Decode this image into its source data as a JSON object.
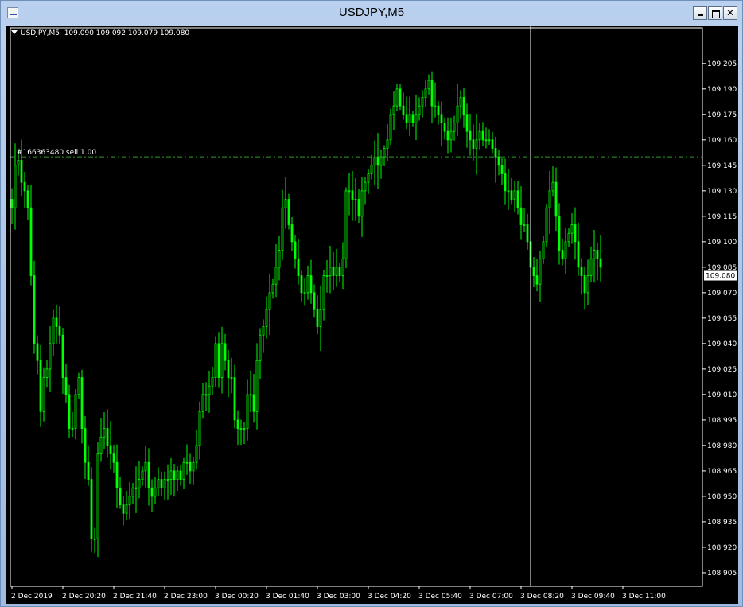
{
  "window": {
    "title": "USDJPY,M5",
    "buttons": {
      "minimize": "minimize",
      "maximize": "maximize",
      "close": "✕"
    }
  },
  "header": {
    "symbol": "USDJPY,M5",
    "ohlc": "109.090 109.092 109.079 109.080"
  },
  "colors": {
    "background": "#000000",
    "bull": "#00ff00",
    "bear": "#00ff00",
    "grid_line": "#ffffff",
    "order_line": "#2e9a2e",
    "price_label_bg": "#ffffff",
    "price_label_text": "#000000"
  },
  "order": {
    "label": "#166363480 sell 1.00",
    "price": 109.15
  },
  "current_price": {
    "value": 109.08,
    "label": "109.080"
  },
  "chart_data": {
    "type": "candlestick",
    "symbol": "USDJPY",
    "timeframe": "M5",
    "ylim": [
      108.897,
      109.226
    ],
    "yticks": [
      "109.205",
      "109.190",
      "109.175",
      "109.160",
      "109.145",
      "109.130",
      "109.115",
      "109.100",
      "109.085",
      "109.070",
      "109.055",
      "109.040",
      "109.025",
      "109.010",
      "108.995",
      "108.980",
      "108.965",
      "108.950",
      "108.935",
      "108.920",
      "108.905"
    ],
    "xticks": [
      "2 Dec 2019",
      "2 Dec 20:20",
      "2 Dec 21:40",
      "2 Dec 23:00",
      "3 Dec 00:20",
      "3 Dec 01:40",
      "3 Dec 03:00",
      "3 Dec 04:20",
      "3 Dec 05:40",
      "3 Dec 07:00",
      "3 Dec 08:20",
      "3 Dec 09:40",
      "3 Dec 11:00"
    ],
    "xtick_bars": [
      0,
      16,
      32,
      48,
      64,
      80,
      96,
      112,
      128,
      144,
      160,
      176,
      192
    ],
    "cursor_bar": 163,
    "series": [
      {
        "close_path": [
          [
            0,
            109.12
          ],
          [
            1,
            109.145
          ],
          [
            2,
            109.148
          ],
          [
            3,
            109.135
          ],
          [
            4,
            109.13
          ],
          [
            5,
            109.12
          ],
          [
            6,
            109.08
          ],
          [
            7,
            109.04
          ],
          [
            8,
            109.03
          ],
          [
            9,
            109.0
          ],
          [
            10,
            109.02
          ],
          [
            11,
            109.025
          ],
          [
            12,
            109.04
          ],
          [
            13,
            109.055
          ],
          [
            14,
            109.05
          ],
          [
            15,
            109.045
          ],
          [
            16,
            109.02
          ],
          [
            17,
            109.01
          ],
          [
            18,
            108.99
          ],
          [
            19,
            108.99
          ],
          [
            20,
            109.01
          ],
          [
            21,
            109.02
          ],
          [
            22,
            108.99
          ],
          [
            23,
            108.97
          ],
          [
            24,
            108.96
          ],
          [
            25,
            108.925
          ],
          [
            26,
            108.925
          ],
          [
            27,
            108.975
          ],
          [
            28,
            108.985
          ],
          [
            29,
            108.99
          ],
          [
            30,
            108.98
          ],
          [
            31,
            108.975
          ],
          [
            32,
            108.97
          ],
          [
            33,
            108.955
          ],
          [
            34,
            108.945
          ],
          [
            35,
            108.94
          ],
          [
            36,
            108.945
          ],
          [
            37,
            108.95
          ],
          [
            38,
            108.955
          ],
          [
            39,
            108.955
          ],
          [
            40,
            108.96
          ],
          [
            41,
            108.965
          ],
          [
            42,
            108.97
          ],
          [
            43,
            108.955
          ],
          [
            44,
            108.95
          ],
          [
            45,
            108.955
          ],
          [
            46,
            108.96
          ],
          [
            47,
            108.955
          ],
          [
            48,
            108.96
          ],
          [
            49,
            108.96
          ],
          [
            50,
            108.965
          ],
          [
            51,
            108.96
          ],
          [
            52,
            108.965
          ],
          [
            53,
            108.96
          ],
          [
            54,
            108.97
          ],
          [
            55,
            108.97
          ],
          [
            56,
            108.965
          ],
          [
            57,
            108.97
          ],
          [
            58,
            108.98
          ],
          [
            59,
            109.0
          ],
          [
            60,
            109.01
          ],
          [
            61,
            109.01
          ],
          [
            62,
            109.015
          ],
          [
            63,
            109.02
          ],
          [
            64,
            109.04
          ],
          [
            65,
            109.02
          ],
          [
            66,
            109.04
          ],
          [
            67,
            109.03
          ],
          [
            68,
            109.02
          ],
          [
            69,
            109.02
          ],
          [
            70,
            108.995
          ],
          [
            71,
            108.99
          ],
          [
            72,
            108.99
          ],
          [
            73,
            108.99
          ],
          [
            74,
            109.01
          ],
          [
            75,
            109.01
          ],
          [
            76,
            109.0
          ],
          [
            77,
            109.03
          ],
          [
            78,
            109.045
          ],
          [
            79,
            109.05
          ],
          [
            80,
            109.06
          ],
          [
            81,
            109.07
          ],
          [
            82,
            109.075
          ],
          [
            83,
            109.085
          ],
          [
            84,
            109.095
          ],
          [
            85,
            109.12
          ],
          [
            86,
            109.125
          ],
          [
            87,
            109.11
          ],
          [
            88,
            109.1
          ],
          [
            89,
            109.09
          ],
          [
            90,
            109.08
          ],
          [
            91,
            109.07
          ],
          [
            92,
            109.07
          ],
          [
            93,
            109.08
          ],
          [
            94,
            109.07
          ],
          [
            95,
            109.06
          ],
          [
            96,
            109.05
          ],
          [
            97,
            109.06
          ],
          [
            98,
            109.08
          ],
          [
            99,
            109.08
          ],
          [
            100,
            109.085
          ],
          [
            101,
            109.08
          ],
          [
            102,
            109.085
          ],
          [
            103,
            109.08
          ],
          [
            104,
            109.09
          ],
          [
            105,
            109.13
          ],
          [
            106,
            109.13
          ],
          [
            107,
            109.125
          ],
          [
            108,
            109.125
          ],
          [
            109,
            109.115
          ],
          [
            110,
            109.13
          ],
          [
            111,
            109.135
          ],
          [
            112,
            109.14
          ],
          [
            113,
            109.145
          ],
          [
            114,
            109.15
          ],
          [
            115,
            109.145
          ],
          [
            116,
            109.15
          ],
          [
            117,
            109.155
          ],
          [
            118,
            109.16
          ],
          [
            119,
            109.175
          ],
          [
            120,
            109.18
          ],
          [
            121,
            109.19
          ],
          [
            122,
            109.18
          ],
          [
            123,
            109.175
          ],
          [
            124,
            109.17
          ],
          [
            125,
            109.175
          ],
          [
            126,
            109.17
          ],
          [
            127,
            109.175
          ],
          [
            128,
            109.18
          ],
          [
            129,
            109.185
          ],
          [
            130,
            109.19
          ],
          [
            131,
            109.195
          ],
          [
            132,
            109.18
          ],
          [
            133,
            109.18
          ],
          [
            134,
            109.175
          ],
          [
            135,
            109.17
          ],
          [
            136,
            109.165
          ],
          [
            137,
            109.16
          ],
          [
            138,
            109.165
          ],
          [
            139,
            109.17
          ],
          [
            140,
            109.18
          ],
          [
            141,
            109.185
          ],
          [
            142,
            109.175
          ],
          [
            143,
            109.165
          ],
          [
            144,
            109.16
          ],
          [
            145,
            109.155
          ],
          [
            146,
            109.16
          ],
          [
            147,
            109.165
          ],
          [
            148,
            109.16
          ],
          [
            149,
            109.16
          ],
          [
            150,
            109.16
          ],
          [
            151,
            109.155
          ],
          [
            152,
            109.15
          ],
          [
            153,
            109.145
          ],
          [
            154,
            109.14
          ],
          [
            155,
            109.13
          ],
          [
            156,
            109.13
          ],
          [
            157,
            109.125
          ],
          [
            158,
            109.13
          ],
          [
            159,
            109.12
          ],
          [
            160,
            109.11
          ],
          [
            161,
            109.11
          ],
          [
            162,
            109.1
          ],
          [
            163,
            109.085
          ],
          [
            164,
            109.08
          ],
          [
            165,
            109.075
          ],
          [
            166,
            109.09
          ],
          [
            167,
            109.1
          ],
          [
            168,
            109.12
          ],
          [
            169,
            109.13
          ],
          [
            170,
            109.135
          ],
          [
            171,
            109.115
          ],
          [
            172,
            109.095
          ],
          [
            173,
            109.09
          ],
          [
            174,
            109.1
          ],
          [
            175,
            109.105
          ],
          [
            176,
            109.11
          ],
          [
            177,
            109.1
          ],
          [
            178,
            109.085
          ],
          [
            179,
            109.08
          ],
          [
            180,
            109.07
          ],
          [
            181,
            109.08
          ],
          [
            182,
            109.09
          ],
          [
            183,
            109.095
          ],
          [
            184,
            109.09
          ],
          [
            185,
            109.085
          ]
        ]
      }
    ]
  }
}
